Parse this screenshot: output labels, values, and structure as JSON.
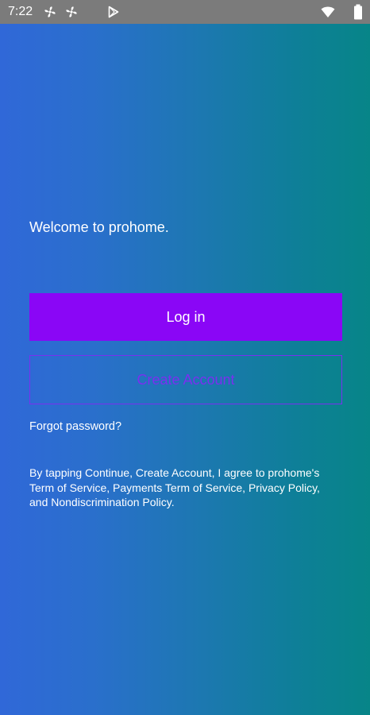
{
  "status_bar": {
    "time": "7:22",
    "icons": [
      "fan-icon",
      "fan-icon",
      "play-store-icon",
      "wifi-icon",
      "battery-icon"
    ]
  },
  "main": {
    "welcome_text": "Welcome to prohome.",
    "login_button_label": "Log in",
    "create_account_button_label": "Create Account",
    "forgot_password_link": "Forgot password?",
    "terms_text": "By tapping Continue, Create Account, I agree to prohome's Term of Service, Payments Term of Service, Privacy Policy, and Nondiscrimination Policy."
  },
  "colors": {
    "gradient_start": "#3068d8",
    "gradient_end": "#078588",
    "primary_button": "#8a06f6",
    "outline_button": "#7a2ff0",
    "status_bar": "#7b7b7b",
    "text": "#ffffff"
  }
}
